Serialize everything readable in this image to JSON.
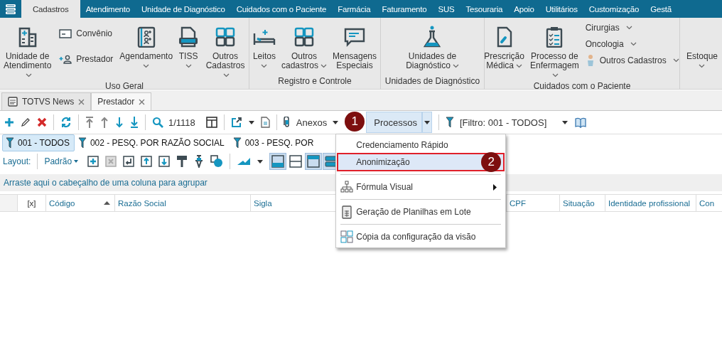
{
  "nav_tabs": [
    {
      "label": "Cadastros",
      "selected": true
    },
    {
      "label": "Atendimento",
      "selected": false
    },
    {
      "label": "Unidade de Diagnóstico",
      "selected": false
    },
    {
      "label": "Cuidados com o Paciente",
      "selected": false
    },
    {
      "label": "Farmácia",
      "selected": false
    },
    {
      "label": "Faturamento",
      "selected": false
    },
    {
      "label": "SUS",
      "selected": false
    },
    {
      "label": "Tesouraria",
      "selected": false
    },
    {
      "label": "Apoio",
      "selected": false
    },
    {
      "label": "Utilitários",
      "selected": false
    },
    {
      "label": "Customização",
      "selected": false
    },
    {
      "label": "Gestã",
      "selected": false
    }
  ],
  "ribbon": {
    "groups": [
      {
        "label": "Uso Geral",
        "items": [
          {
            "kind": "large",
            "label": "Unidade de\nAtendimento",
            "dropdown": true
          },
          {
            "kind": "column",
            "children": [
              {
                "label": "Convênio",
                "dropdown": false
              },
              {
                "label": "Prestador",
                "dropdown": false
              }
            ]
          },
          {
            "kind": "large",
            "label": "Agendamento",
            "dropdown": true
          },
          {
            "kind": "large",
            "label": "TISS",
            "dropdown": true
          },
          {
            "kind": "large",
            "label": "Outros\nCadastros",
            "dropdown": true
          }
        ]
      },
      {
        "label": "Registro e Controle",
        "items": [
          {
            "kind": "large",
            "label": "Leitos",
            "dropdown": true
          },
          {
            "kind": "large",
            "label": "Outros\ncadastros",
            "dropdown": true
          },
          {
            "kind": "large",
            "label": "Mensagens\nEspeciais",
            "dropdown": false
          }
        ]
      },
      {
        "label": "Unidades de Diagnóstico",
        "items": [
          {
            "kind": "large",
            "label": "Unidades de\nDiagnóstico",
            "dropdown": true
          }
        ]
      },
      {
        "label": "Cuidados com o Paciente",
        "items": [
          {
            "kind": "large",
            "label": "Prescrição\nMédica",
            "dropdown": true
          },
          {
            "kind": "large",
            "label": "Processo de\nEnfermagem",
            "dropdown": true
          },
          {
            "kind": "column",
            "children": [
              {
                "label": "Cirurgias",
                "dropdown": true
              },
              {
                "label": "Oncologia",
                "dropdown": true
              },
              {
                "label": "Outros Cadastros",
                "dropdown": true
              }
            ]
          }
        ]
      },
      {
        "items": [
          {
            "kind": "large",
            "label": "Estoque",
            "dropdown": true
          }
        ]
      }
    ]
  },
  "document_tabs": [
    {
      "label": "TOTVS News",
      "selected": false
    },
    {
      "label": "Prestador",
      "selected": true
    }
  ],
  "toolbar": {
    "record_counter": "1/1118",
    "attachments": "Anexos",
    "processes": {
      "label": "Processos",
      "expanded": true
    },
    "filter": "[Filtro: 001 - TODOS]"
  },
  "filter_tabs": [
    {
      "label": "001 - TODOS",
      "selected": true
    },
    {
      "label": "002 - PESQ. POR  RAZÃO SOCIAL",
      "selected": false
    },
    {
      "label": "003 - PESQ. POR",
      "selected": false
    }
  ],
  "layout_toolbar": {
    "label": "Layout:",
    "preset": "Padrão",
    "toggles": [
      {
        "selected": true
      },
      {
        "selected": false
      },
      {
        "selected": true
      },
      {
        "selected": true
      }
    ]
  },
  "group_panel": "Arraste aqui o cabeçalho de uma coluna para agrupar",
  "table": {
    "columns": [
      {
        "label": "[x]",
        "sorted": false
      },
      {
        "label": "Código",
        "sorted": true
      },
      {
        "label": "Razão Social",
        "sorted": false
      },
      {
        "label": "Sigla",
        "sorted": false
      },
      {
        "label": "CPF",
        "sorted": false
      },
      {
        "label": "Situação",
        "sorted": false
      },
      {
        "label": "Identidade profissional",
        "sorted": false
      },
      {
        "label": "Con",
        "sorted": false
      }
    ]
  },
  "processes_menu": [
    {
      "kind": "item",
      "label": "Credenciamento Rápido",
      "selected": false,
      "outlined": false,
      "submenu": false
    },
    {
      "kind": "item",
      "label": "Anonimização",
      "selected": true,
      "outlined": true,
      "submenu": false
    },
    {
      "kind": "separator"
    },
    {
      "kind": "item",
      "label": "Fórmula Visual",
      "selected": false,
      "outlined": false,
      "submenu": true
    },
    {
      "kind": "separator"
    },
    {
      "kind": "item",
      "label": "Geração de Planilhas em Lote",
      "selected": false,
      "outlined": false,
      "submenu": false
    },
    {
      "kind": "separator"
    },
    {
      "kind": "item",
      "label": "Cópia da configuração da visão",
      "selected": false,
      "outlined": false,
      "submenu": false
    }
  ],
  "callouts": [
    {
      "label": "1"
    },
    {
      "label": "2"
    }
  ]
}
